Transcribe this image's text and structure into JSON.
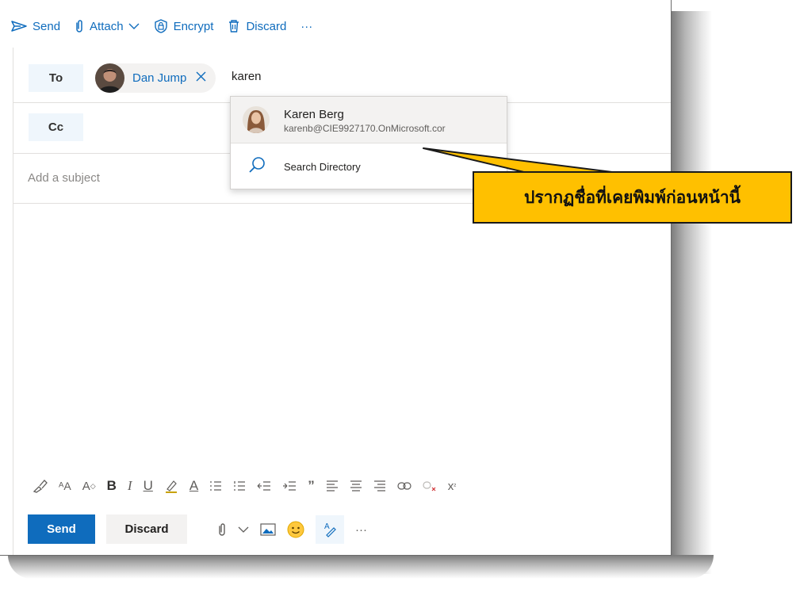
{
  "toolbar": {
    "send": "Send",
    "attach": "Attach",
    "encrypt": "Encrypt",
    "discard": "Discard",
    "more": "···"
  },
  "recipients": {
    "to_label": "To",
    "cc_label": "Cc",
    "to_chip_name": "Dan Jump",
    "typed_text": "karen"
  },
  "suggestions": {
    "items": [
      {
        "name": "Karen Berg",
        "email": "karenb@CIE9927170.OnMicrosoft.cor"
      }
    ],
    "search_directory": "Search Directory"
  },
  "subject": {
    "placeholder": "Add a subject"
  },
  "actions": {
    "send": "Send",
    "discard": "Discard",
    "more": "···"
  },
  "callout": {
    "text": "ปรากฏชื่อที่เคยพิมพ์ก่อนหน้านี้"
  },
  "colors": {
    "accent": "#0f6cbd",
    "callout_fill": "#ffc000",
    "chip_bg": "#f3f2f1",
    "label_bg": "#eff6fc"
  },
  "icons": {
    "toolbar": [
      "send-icon",
      "attach-icon",
      "chevron-down-icon",
      "encrypt-icon",
      "discard-icon",
      "more-icon"
    ],
    "format": [
      "format-painter-icon",
      "font-size-icon",
      "grow-font-icon",
      "bold-icon",
      "italic-icon",
      "underline-icon",
      "highlight-icon",
      "font-color-icon",
      "bullets-icon",
      "numbering-icon",
      "decrease-indent-icon",
      "increase-indent-icon",
      "quote-icon",
      "align-left-icon",
      "align-center-icon",
      "align-right-icon",
      "link-icon",
      "remove-link-icon",
      "superscript-icon"
    ],
    "bottom": [
      "attach-icon",
      "chevron-down-icon",
      "insert-picture-icon",
      "emoji-icon",
      "signature-icon",
      "more-icon"
    ]
  }
}
